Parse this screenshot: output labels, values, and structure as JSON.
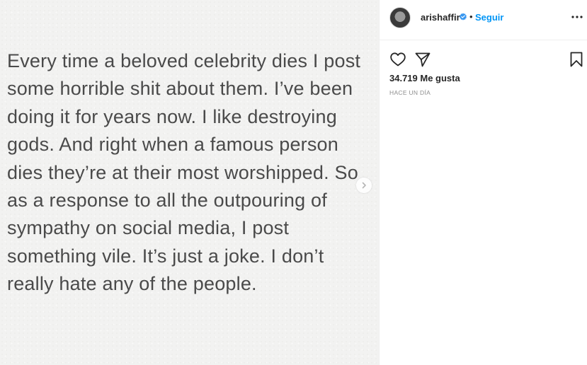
{
  "media": {
    "text": "Every time a beloved celebrity dies I post\nsome horrible shit about them. I’ve been\ndoing it for years now. I like destroying\ngods. And right when a famous person\ndies they’re at their most worshipped. So\nas a response to all the outpouring of\nsympathy on social media, I post\nsomething vile. It’s just a joke. I don’t\nreally hate any of the people."
  },
  "header": {
    "username": "arishaffir",
    "verified_icon": "verified-badge-icon",
    "separator": "•",
    "follow_label": "Seguir",
    "more_icon": "more-options-icon"
  },
  "actions": {
    "like_icon": "heart-icon",
    "share_icon": "paper-plane-icon",
    "save_icon": "bookmark-icon"
  },
  "stats": {
    "likes": "34.719 Me gusta",
    "timestamp": "HACE UN DÍA"
  },
  "colors": {
    "accent": "#0095f6",
    "text": "#262626",
    "muted": "#8e8e8e",
    "media_text": "#4a4a4a"
  }
}
